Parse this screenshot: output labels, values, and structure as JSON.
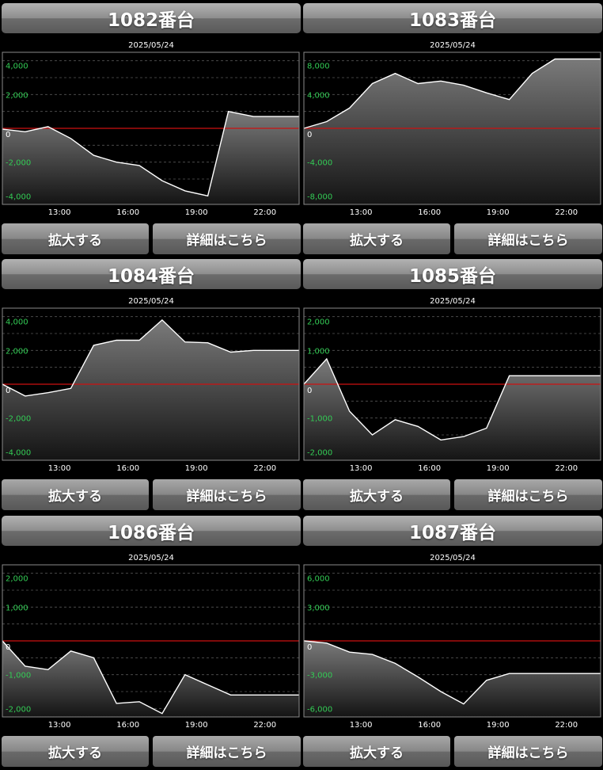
{
  "panels": [
    {
      "id": "1082",
      "title": "1082番台",
      "buttons": {
        "zoom": "拡大する",
        "detail": "詳細はこちら"
      },
      "chart_data": {
        "type": "area",
        "title": "2025/05/24",
        "ylim": [
          -4500,
          4500
        ],
        "yticks": [
          4000,
          2000,
          0,
          -2000,
          -4000
        ],
        "ytick_labels": [
          "4,000",
          "2,000",
          "0",
          "-2,000",
          "-4,000"
        ],
        "xlim": [
          10.5,
          23.5
        ],
        "xticks": [
          13,
          16,
          19,
          22
        ],
        "xtick_labels": [
          "13:00",
          "16:00",
          "19:00",
          "22:00"
        ],
        "x": [
          10.5,
          11.5,
          12.5,
          13.5,
          14.5,
          15.5,
          16.5,
          17.5,
          18.5,
          19.5,
          20.4,
          21.5,
          23.5
        ],
        "values": [
          -50,
          -200,
          100,
          -600,
          -1600,
          -2000,
          -2200,
          -3100,
          -3700,
          -4000,
          1000,
          700,
          700
        ]
      }
    },
    {
      "id": "1083",
      "title": "1083番台",
      "buttons": {
        "zoom": "拡大する",
        "detail": "詳細はこちら"
      },
      "chart_data": {
        "type": "area",
        "title": "2025/05/24",
        "ylim": [
          -9000,
          9000
        ],
        "yticks": [
          8000,
          4000,
          0,
          -4000,
          -8000
        ],
        "ytick_labels": [
          "8,000",
          "4,000",
          "0",
          "-4,000",
          "-8,000"
        ],
        "xlim": [
          10.5,
          23.5
        ],
        "xticks": [
          13,
          16,
          19,
          22
        ],
        "xtick_labels": [
          "13:00",
          "16:00",
          "19:00",
          "22:00"
        ],
        "x": [
          10.5,
          11.5,
          12.5,
          13.5,
          14.5,
          15.5,
          16.5,
          17.5,
          18.5,
          19.5,
          20.5,
          21.5,
          23.5
        ],
        "values": [
          0,
          800,
          2400,
          5300,
          6500,
          5300,
          5600,
          5100,
          4200,
          3400,
          6500,
          8200,
          8200
        ]
      }
    },
    {
      "id": "1084",
      "title": "1084番台",
      "buttons": {
        "zoom": "拡大する",
        "detail": "詳細はこちら"
      },
      "chart_data": {
        "type": "area",
        "title": "2025/05/24",
        "ylim": [
          -4500,
          4500
        ],
        "yticks": [
          4000,
          2000,
          0,
          -2000,
          -4000
        ],
        "ytick_labels": [
          "4,000",
          "2,000",
          "0",
          "-2,000",
          "-4,000"
        ],
        "xlim": [
          10.5,
          23.5
        ],
        "xticks": [
          13,
          16,
          19,
          22
        ],
        "xtick_labels": [
          "13:00",
          "16:00",
          "19:00",
          "22:00"
        ],
        "x": [
          10.5,
          11.5,
          12.5,
          13.5,
          14.5,
          15.5,
          16.5,
          17.5,
          18.5,
          19.5,
          20.5,
          21.5,
          23.5
        ],
        "values": [
          0,
          -700,
          -500,
          -250,
          2300,
          2600,
          2600,
          3800,
          2500,
          2450,
          1900,
          2000,
          2000
        ]
      }
    },
    {
      "id": "1085",
      "title": "1085番台",
      "buttons": {
        "zoom": "拡大する",
        "detail": "詳細はこちら"
      },
      "chart_data": {
        "type": "area",
        "title": "2025/05/24",
        "ylim": [
          -2250,
          2250
        ],
        "yticks": [
          2000,
          1000,
          0,
          -1000,
          -2000
        ],
        "ytick_labels": [
          "2,000",
          "1,000",
          "0",
          "-1,000",
          "-2,000"
        ],
        "xlim": [
          10.5,
          23.5
        ],
        "xticks": [
          13,
          16,
          19,
          22
        ],
        "xtick_labels": [
          "13:00",
          "16:00",
          "19:00",
          "22:00"
        ],
        "x": [
          10.5,
          11.5,
          12.5,
          13.5,
          14.5,
          15.5,
          16.5,
          17.5,
          18.5,
          19.5,
          20.5,
          21.5,
          23.5
        ],
        "values": [
          0,
          750,
          -800,
          -1500,
          -1050,
          -1250,
          -1650,
          -1550,
          -1300,
          250,
          250,
          250,
          250
        ]
      }
    },
    {
      "id": "1086",
      "title": "1086番台",
      "buttons": {
        "zoom": "拡大する",
        "detail": "詳細はこちら"
      },
      "chart_data": {
        "type": "area",
        "title": "2025/05/24",
        "ylim": [
          -2250,
          2250
        ],
        "yticks": [
          2000,
          1000,
          0,
          -1000,
          -2000
        ],
        "ytick_labels": [
          "2,000",
          "1,000",
          "0",
          "-1,000",
          "-2,000"
        ],
        "xlim": [
          10.5,
          23.5
        ],
        "xticks": [
          13,
          16,
          19,
          22
        ],
        "xtick_labels": [
          "13:00",
          "16:00",
          "19:00",
          "22:00"
        ],
        "x": [
          10.5,
          11.5,
          12.5,
          13.5,
          14.5,
          15.5,
          16.5,
          17.5,
          18.5,
          19.5,
          20.5,
          21.5,
          23.5
        ],
        "values": [
          0,
          -750,
          -850,
          -300,
          -500,
          -1850,
          -1800,
          -2150,
          -1000,
          -1300,
          -1600,
          -1600,
          -1600
        ]
      }
    },
    {
      "id": "1087",
      "title": "1087番台",
      "buttons": {
        "zoom": "拡大する",
        "detail": "詳細はこちら"
      },
      "chart_data": {
        "type": "area",
        "title": "2025/05/24",
        "ylim": [
          -6750,
          6750
        ],
        "yticks": [
          6000,
          3000,
          0,
          -3000,
          -6000
        ],
        "ytick_labels": [
          "6,000",
          "3,000",
          "0",
          "-3,000",
          "-6,000"
        ],
        "xlim": [
          10.5,
          23.5
        ],
        "xticks": [
          13,
          16,
          19,
          22
        ],
        "xtick_labels": [
          "13:00",
          "16:00",
          "19:00",
          "22:00"
        ],
        "x": [
          10.5,
          11.5,
          12.5,
          13.5,
          14.5,
          15.5,
          16.5,
          17.5,
          18.5,
          19.5,
          20.5,
          21.5,
          23.5
        ],
        "values": [
          0,
          -200,
          -1000,
          -1200,
          -2000,
          -3200,
          -4500,
          -5600,
          -3500,
          -2900,
          -2900,
          -2900,
          -2900
        ]
      }
    }
  ],
  "colors": {
    "axis_label": "#33cc55",
    "zero_line": "#cc1111",
    "series_line": "#ffffff",
    "grid": "#555555",
    "frame": "#8a8a8a"
  }
}
